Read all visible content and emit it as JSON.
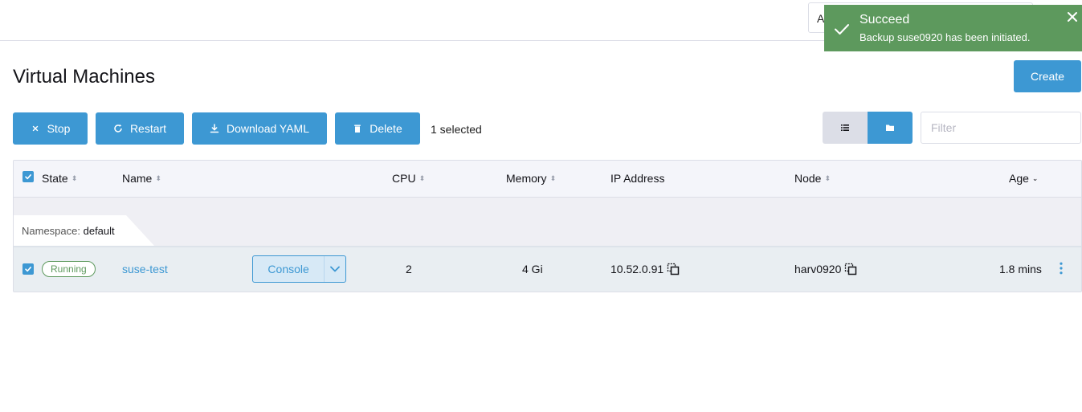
{
  "header": {
    "namespace_value": "A"
  },
  "toast": {
    "title": "Succeed",
    "message": "Backup suse0920 has been initiated.",
    "icons": [
      "check-icon",
      "close-icon"
    ],
    "color": "#5d995d"
  },
  "page": {
    "title": "Virtual Machines",
    "create_label": "Create"
  },
  "toolbar": {
    "stop_label": "Stop",
    "restart_label": "Restart",
    "download_yaml_label": "Download YAML",
    "delete_label": "Delete",
    "selected_text": "1 selected",
    "filter_placeholder": "Filter"
  },
  "table": {
    "columns": {
      "state": "State",
      "name": "Name",
      "cpu": "CPU",
      "memory": "Memory",
      "ip_address": "IP Address",
      "node": "Node",
      "age": "Age"
    },
    "group": {
      "label": "Namespace:",
      "value": "default"
    },
    "rows": [
      {
        "state": "Running",
        "name": "suse-test",
        "console_label": "Console",
        "cpu": "2",
        "memory": "4 Gi",
        "ip_address": "10.52.0.91",
        "node": "harv0920",
        "age": "1.8 mins"
      }
    ]
  },
  "colors": {
    "accent": "#3d98d3",
    "success": "#5d995d",
    "border": "#dcdee7"
  }
}
